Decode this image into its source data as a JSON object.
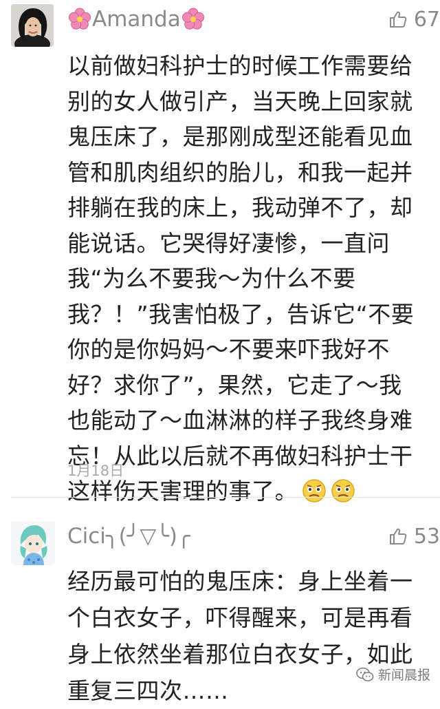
{
  "comments": [
    {
      "username": "Amanda",
      "likes": "67",
      "text": "以前做妇科护士的时候工作需要给别的女人做引产，当天晚上回家就鬼压床了，是那刚成型还能看见血管和肌肉组织的胎儿，和我一起并排躺在我的床上，我动弹不了，却能说话。它哭得好凄惨，一直问我“为么不要我～为什么不要我？！”我害怕极了，告诉它“不要你的是你妈妈～不要来吓我好不好？求你了”，果然，它走了～我也能动了～血淋淋的样子我终身难忘！从此以后就不再做妇科护士干这样伤天害理的事了。",
      "date": "1月18日",
      "avatar_icon": "woman-portrait-avatar",
      "name_decoration_icon": "pink-flower-icon",
      "trailing_emoji_icon": "worried-face-emoji"
    },
    {
      "username": "Cici╮(╯▽╰)╭",
      "likes": "53",
      "text": "经历最可怕的鬼压床：身上坐着一个白衣女子，吓得醒来，可是再看身上依然坐着那位白衣女子，如此重复三四次……",
      "avatar_icon": "anime-girl-avatar"
    }
  ],
  "watermark": {
    "text": "新闻晨报",
    "icon": "wechat-official-account-icon"
  },
  "colors": {
    "username": "#8a8a8a",
    "body_text": "#222222",
    "date": "#aaaaaa",
    "divider": "#e6e6e6",
    "flower": "#f08ab4"
  }
}
